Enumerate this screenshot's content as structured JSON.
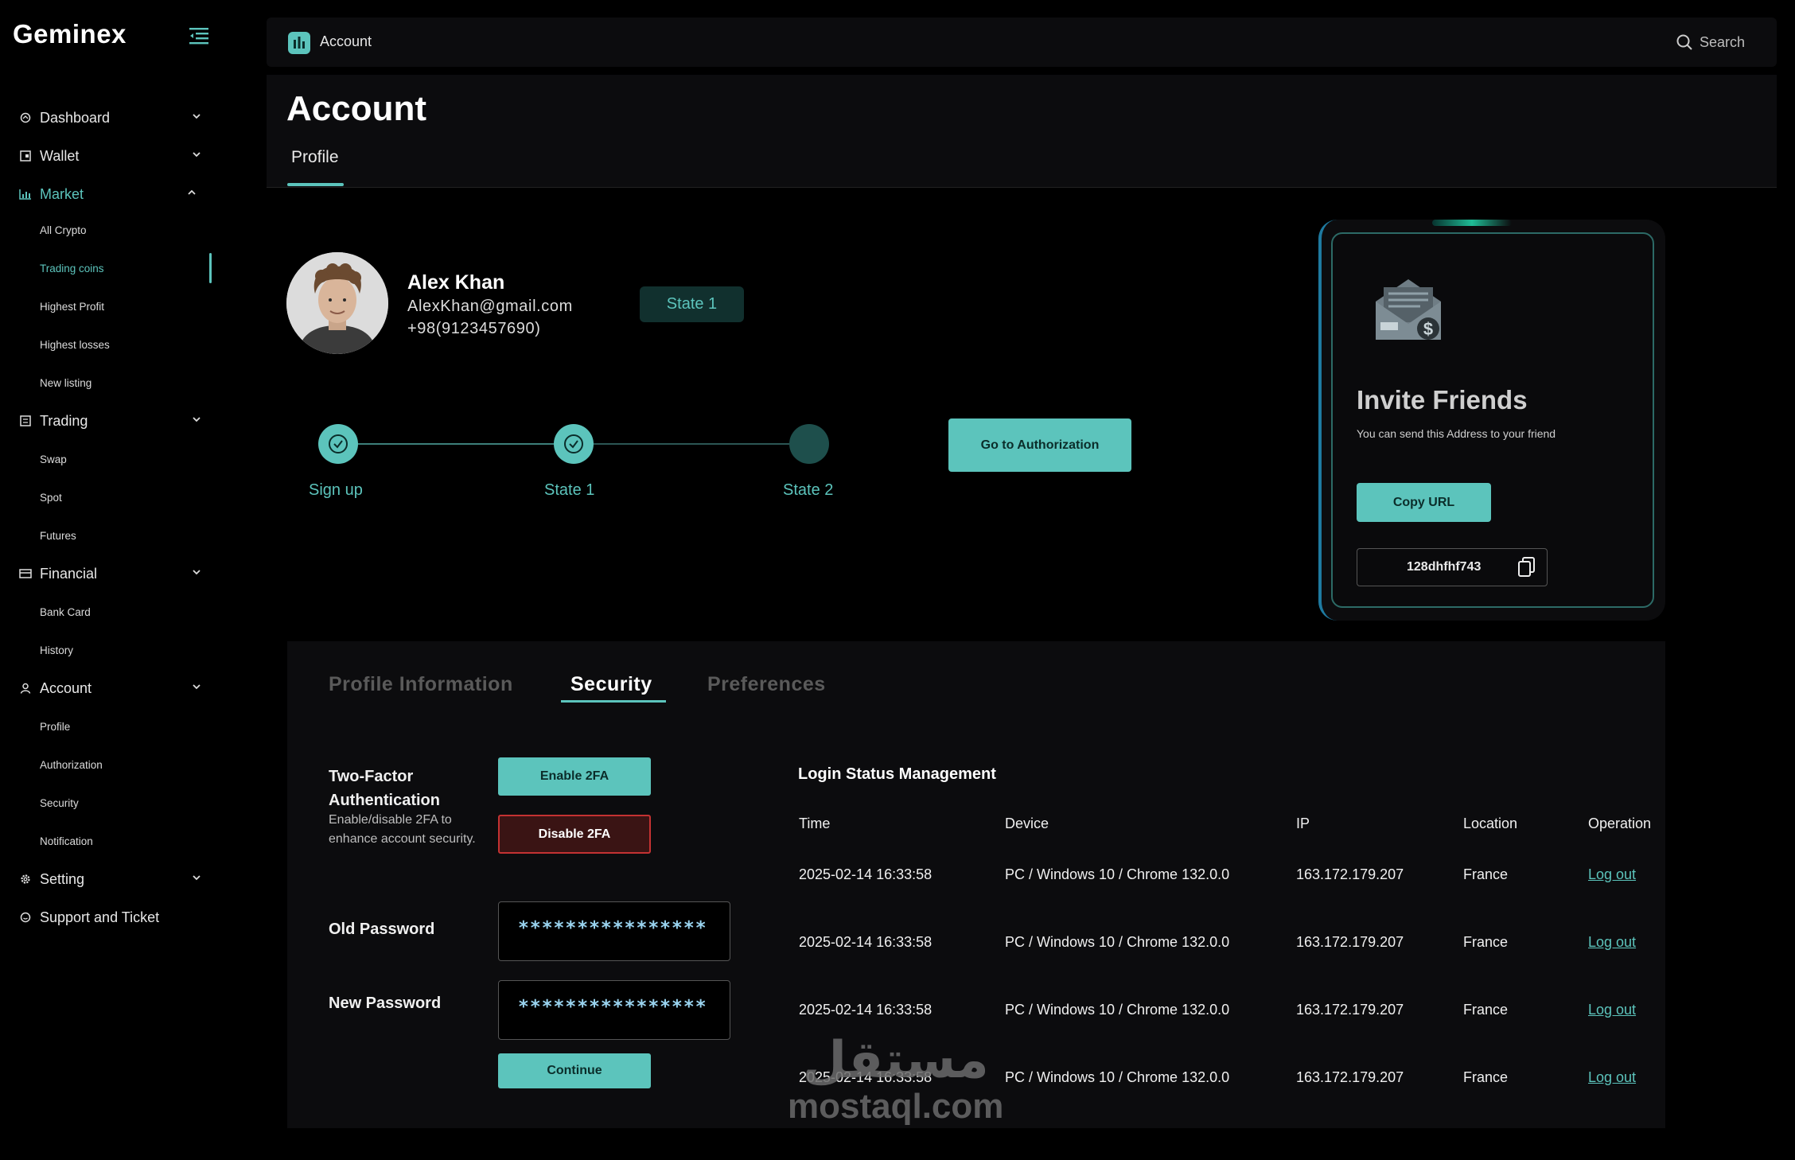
{
  "app": {
    "name": "Geminex"
  },
  "sidebar": {
    "items": [
      {
        "label": "Dashboard"
      },
      {
        "label": "Wallet"
      },
      {
        "label": "Market"
      },
      {
        "label": "Trading"
      },
      {
        "label": "Financial"
      },
      {
        "label": "Account"
      },
      {
        "label": "Setting"
      },
      {
        "label": "Support and Ticket"
      }
    ],
    "market_sub": [
      "All Crypto",
      "Trading coins",
      "Highest Profit",
      "Highest losses",
      "New listing"
    ],
    "trading_sub": [
      "Swap",
      "Spot",
      "Futures"
    ],
    "financial_sub": [
      "Bank Card",
      "History"
    ],
    "account_sub": [
      "Profile",
      "Authorization",
      "Security",
      "Notification"
    ]
  },
  "header": {
    "title": "Account",
    "search_label": "Search"
  },
  "page": {
    "title": "Account",
    "tab": "Profile"
  },
  "profile": {
    "name": "Alex Khan",
    "email": "AlexKhan@gmail.com",
    "phone": "+98(9123457690)",
    "state": "State 1"
  },
  "progress": {
    "steps": [
      {
        "label": "Sign up",
        "done": true
      },
      {
        "label": "State 1",
        "done": true
      },
      {
        "label": "State 2",
        "done": false
      }
    ],
    "auth_button": "Go to Authorization"
  },
  "invite": {
    "title": "Invite Friends",
    "subtitle": "You can send  this Address to your friend",
    "copy_button": "Copy URL",
    "code": "128dhfhf743"
  },
  "tabs": {
    "items": [
      "Profile Information",
      "Security",
      "Preferences"
    ],
    "active": "Security"
  },
  "security": {
    "tfa_title": "Two-Factor Authentication",
    "tfa_desc": "Enable/disable 2FA to enhance account security.",
    "enable_button": "Enable 2FA",
    "disable_button": "Disable 2FA",
    "old_password_label": "Old Password",
    "old_password_value": "****************",
    "new_password_label": "New Password",
    "new_password_value": "****************",
    "continue_button": "Continue"
  },
  "login_status": {
    "title": "Login Status Management",
    "columns": [
      "Time",
      "Device",
      "IP",
      "Location",
      "Operation"
    ],
    "rows": [
      {
        "time": "2025-02-14 16:33:58",
        "device": "PC / Windows 10 / Chrome 132.0.0",
        "ip": "163.172.179.207",
        "location": "France",
        "op": "Log out"
      },
      {
        "time": "2025-02-14 16:33:58",
        "device": "PC / Windows 10 / Chrome 132.0.0",
        "ip": "163.172.179.207",
        "location": "France",
        "op": "Log out"
      },
      {
        "time": "2025-02-14 16:33:58",
        "device": "PC / Windows 10 / Chrome 132.0.0",
        "ip": "163.172.179.207",
        "location": "France",
        "op": "Log out"
      },
      {
        "time": "2025-02-14 16:33:58",
        "device": "PC / Windows 10 / Chrome 132.0.0",
        "ip": "163.172.179.207",
        "location": "France",
        "op": "Log out"
      }
    ]
  },
  "watermark": {
    "arabic": "مستقل",
    "latin": "mostaql.com"
  },
  "colors": {
    "accent": "#5cc4bc",
    "danger": "#c43232",
    "panel": "#0c0c0e",
    "background": "#000000"
  }
}
